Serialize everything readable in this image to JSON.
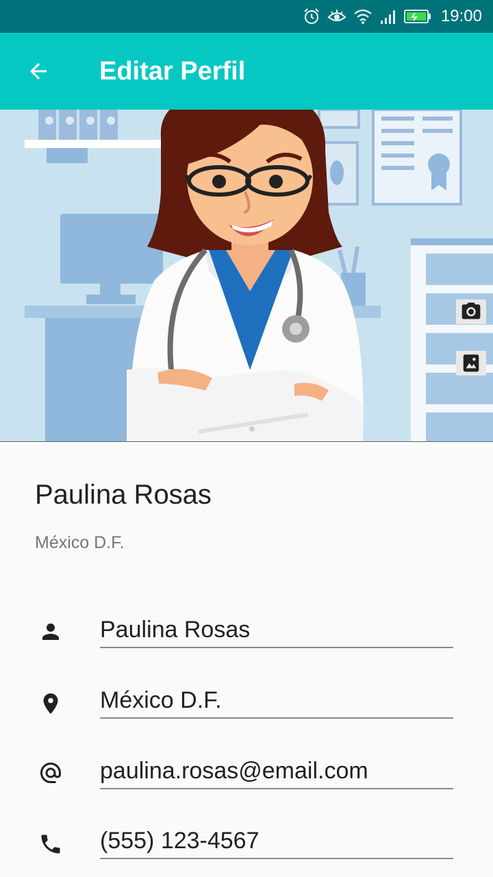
{
  "status_bar": {
    "time": "19:00",
    "icons": [
      "alarm-icon",
      "eye-icon",
      "wifi-icon",
      "signal-icon",
      "battery-charging-icon"
    ]
  },
  "app_bar": {
    "title": "Editar Perfil",
    "back_icon": "arrow-back-icon",
    "color": "#06c8c2"
  },
  "hero": {
    "image": "doctor-illustration",
    "actions": [
      "camera-icon",
      "gallery-icon"
    ]
  },
  "profile": {
    "name": "Paulina Rosas",
    "city": "México D.F."
  },
  "fields": {
    "name": {
      "icon": "person-icon",
      "value": "Paulina Rosas"
    },
    "location": {
      "icon": "location-icon",
      "value": "México D.F."
    },
    "email": {
      "icon": "at-icon",
      "value": "paulina.rosas@email.com"
    },
    "phone": {
      "icon": "phone-icon",
      "value": "(555) 123-4567"
    }
  }
}
